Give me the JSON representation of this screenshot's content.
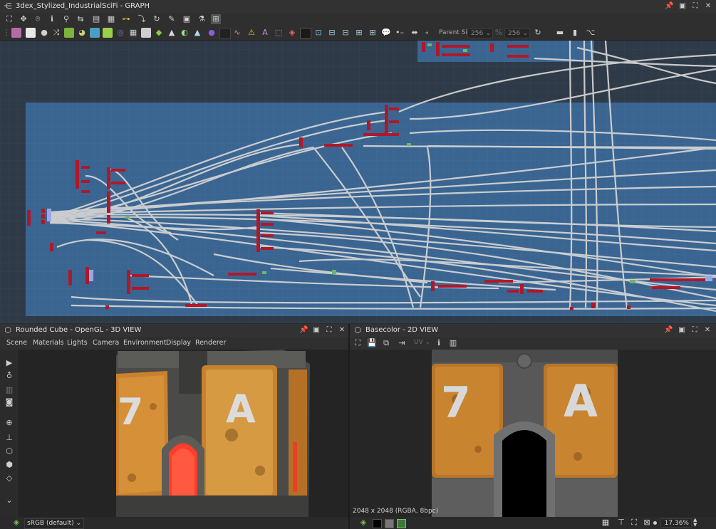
{
  "graph": {
    "title": "3dex_Stylized_IndustrialSciFi - GRAPH",
    "parent_size_label": "Parent Size:",
    "parent_size_value": "256",
    "size_value_2": "256",
    "colors": {
      "graph_bg": "#2e3a49",
      "frame": "#3a6590",
      "node_red": "#b0182a",
      "wire": "#d9d9d9"
    }
  },
  "view3d": {
    "title": "Rounded Cube - OpenGL - 3D VIEW",
    "menu": [
      "Scene",
      "Materials",
      "Lights",
      "Camera",
      "Environment",
      "Display",
      "Renderer"
    ],
    "colorspace": "sRGB (default)",
    "decal_left": "7",
    "decal_right": "A"
  },
  "view2d": {
    "title": "Basecolor - 2D VIEW",
    "uv_label": "UV",
    "image_info": "2048 x 2048 (RGBA, 8bpc)",
    "zoom": "17.36%",
    "decal_left": "7",
    "decal_right": "A"
  }
}
